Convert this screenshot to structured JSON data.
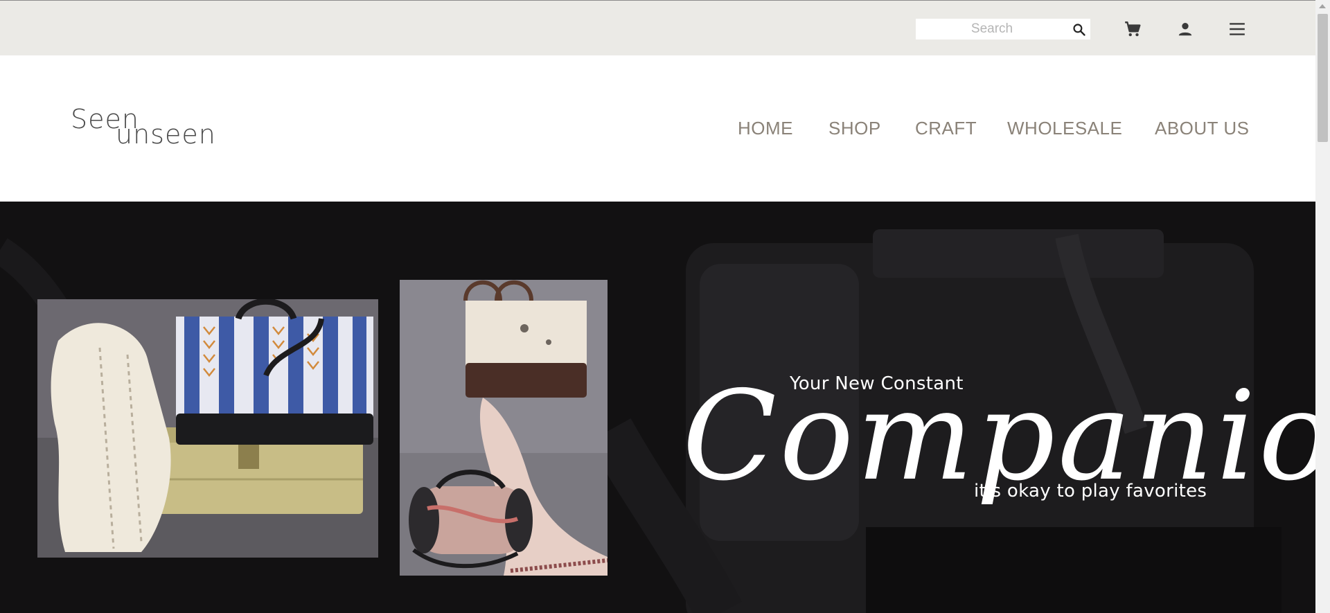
{
  "search": {
    "placeholder": "Search",
    "icon": "magnifier-icon"
  },
  "utility_icons": [
    "cart-icon",
    "account-icon",
    "hamburger-menu-icon"
  ],
  "logo": {
    "line1": "Seen",
    "line2": "unseen"
  },
  "nav": {
    "items": [
      {
        "label": "HOME"
      },
      {
        "label": "SHOP"
      },
      {
        "label": "CRAFT"
      },
      {
        "label": "WHOLESALE"
      },
      {
        "label": "ABOUT US"
      }
    ]
  },
  "hero": {
    "kicker": "Your New Constant",
    "headline": "Companion",
    "tagline": "it's okay to play favorites",
    "photos": [
      "striped-tote-bag-photo",
      "cream-tote-and-duffel-photo"
    ]
  },
  "colors": {
    "topbar_bg": "#ebeae6",
    "nav_text": "#8a8278",
    "hero_bg": "#121112",
    "hero_text": "#ffffff"
  }
}
